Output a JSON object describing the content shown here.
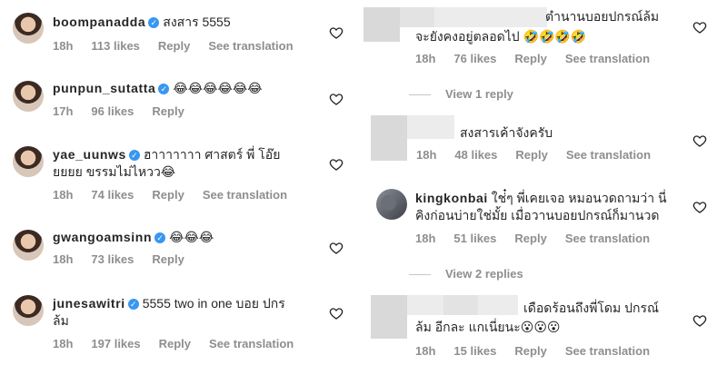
{
  "left": [
    {
      "username": "boompanadda",
      "text": "สงสาร 5555",
      "time": "18h",
      "likes": "113 likes",
      "reply": "Reply",
      "see": "See translation"
    },
    {
      "username": "punpun_sutatta",
      "text": "😂😂😂😂😂😂",
      "time": "17h",
      "likes": "96 likes",
      "reply": "Reply",
      "see": ""
    },
    {
      "username": "yae_uunws",
      "text": "ฮาาาาาาา ศาสตร์ พี่ โอ๊ย",
      "text2": "ยยยย ขรรมไม่ไหวว😂",
      "time": "18h",
      "likes": "74 likes",
      "reply": "Reply",
      "see": "See translation"
    },
    {
      "username": "gwangoamsinn",
      "text": "😂😂😂",
      "time": "18h",
      "likes": "73 likes",
      "reply": "Reply",
      "see": ""
    },
    {
      "username": "junesawitri",
      "text": "5555 two in one บอย ปกร",
      "text2": "ล้ม",
      "time": "18h",
      "likes": "197 likes",
      "reply": "Reply",
      "see": "See translation"
    }
  ],
  "right": [
    {
      "username": "",
      "text": "ตำนานบอยปกรณ์ล้ม",
      "text2": "จะยังคงอยู่ตลอดไป 🤣🤣🤣🤣",
      "time": "18h",
      "likes": "76 likes",
      "reply": "Reply",
      "see": "See translation"
    },
    {
      "username": "",
      "text": "สงสารเค้าจังครับ",
      "time": "18h",
      "likes": "48 likes",
      "reply": "Reply",
      "see": "See translation"
    },
    {
      "username": "kingkonbai",
      "text": "ใช่๋ๆ พี่เคยเจอ หมอนวดถามว่า นี่",
      "text2": "คิงก่อนบ่ายใช่มั้ย เมื่อวานบอยปกรณ์ก็มานวด",
      "time": "18h",
      "likes": "51 likes",
      "reply": "Reply",
      "see": "See translation"
    },
    {
      "username": "",
      "text": "เดือดร้อนถึงพี่โดม ปกรณ์",
      "text2": "ล้ม อีกละ แกเนี่ยนะ😮😮😮",
      "time": "18h",
      "likes": "15 likes",
      "reply": "Reply",
      "see": "See translation"
    }
  ],
  "view_replies": [
    "View 1 reply",
    "View 2 replies"
  ],
  "icons": {
    "heart": "heart-outline-icon",
    "verified": "verified-badge-icon"
  },
  "colors": {
    "meta": "#8e8e8e",
    "verified": "#3897f0",
    "text": "#262626"
  }
}
